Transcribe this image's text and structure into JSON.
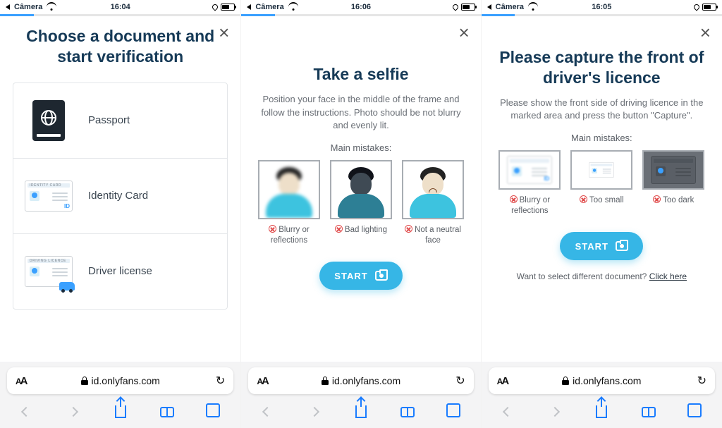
{
  "screens": [
    {
      "status": {
        "back_app": "Câmera",
        "time": "16:04",
        "progress_pct": 14
      },
      "title": "Choose a document and start verification",
      "documents": [
        {
          "label": "Passport"
        },
        {
          "label": "Identity Card"
        },
        {
          "label": "Driver license"
        }
      ],
      "url": "id.onlyfans.com"
    },
    {
      "status": {
        "back_app": "Câmera",
        "time": "16:06",
        "progress_pct": 14
      },
      "title": "Take a selfie",
      "subtitle": "Position your face in the middle of the frame and follow the instructions. Photo should be not blurry and evenly lit.",
      "mistakes_label": "Main mistakes:",
      "mistakes": [
        {
          "caption": "Blurry or reflections"
        },
        {
          "caption": "Bad lighting"
        },
        {
          "caption": "Not a neutral face"
        }
      ],
      "start_label": "START",
      "url": "id.onlyfans.com"
    },
    {
      "status": {
        "back_app": "Câmera",
        "time": "16:05",
        "progress_pct": 14
      },
      "title": "Please capture the front of driver's licence",
      "subtitle": "Please show the front side of driving licence in the marked area and press the button \"Capture\".",
      "mistakes_label": "Main mistakes:",
      "mistakes": [
        {
          "caption": "Blurry or reflections"
        },
        {
          "caption": "Too small"
        },
        {
          "caption": "Too dark"
        }
      ],
      "start_label": "START",
      "diff_prompt": "Want to select different document?",
      "diff_link": "Click here",
      "url": "id.onlyfans.com"
    }
  ],
  "id_tag": "ID",
  "idcard_title": "IDENTITY CARD",
  "dl_title": "DRIVING LICENCE"
}
